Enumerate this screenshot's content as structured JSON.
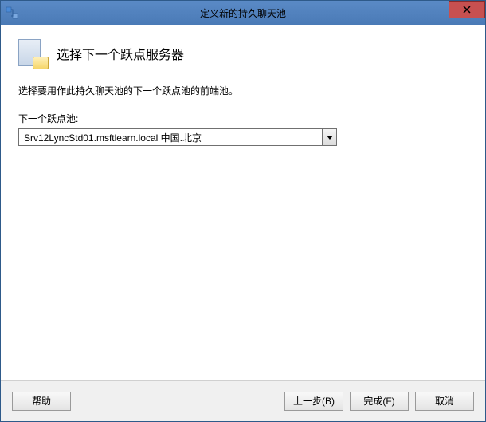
{
  "window": {
    "title": "定义新的持久聊天池"
  },
  "header": {
    "title": "选择下一个跃点服务器"
  },
  "body": {
    "description": "选择要用作此持久聊天池的下一个跃点池的前端池。",
    "dropdown_label": "下一个跃点池:",
    "dropdown_value": "Srv12LyncStd01.msftlearn.local   中国.北京"
  },
  "footer": {
    "help": "帮助",
    "back": "上一步(B)",
    "finish": "完成(F)",
    "cancel": "取消"
  }
}
